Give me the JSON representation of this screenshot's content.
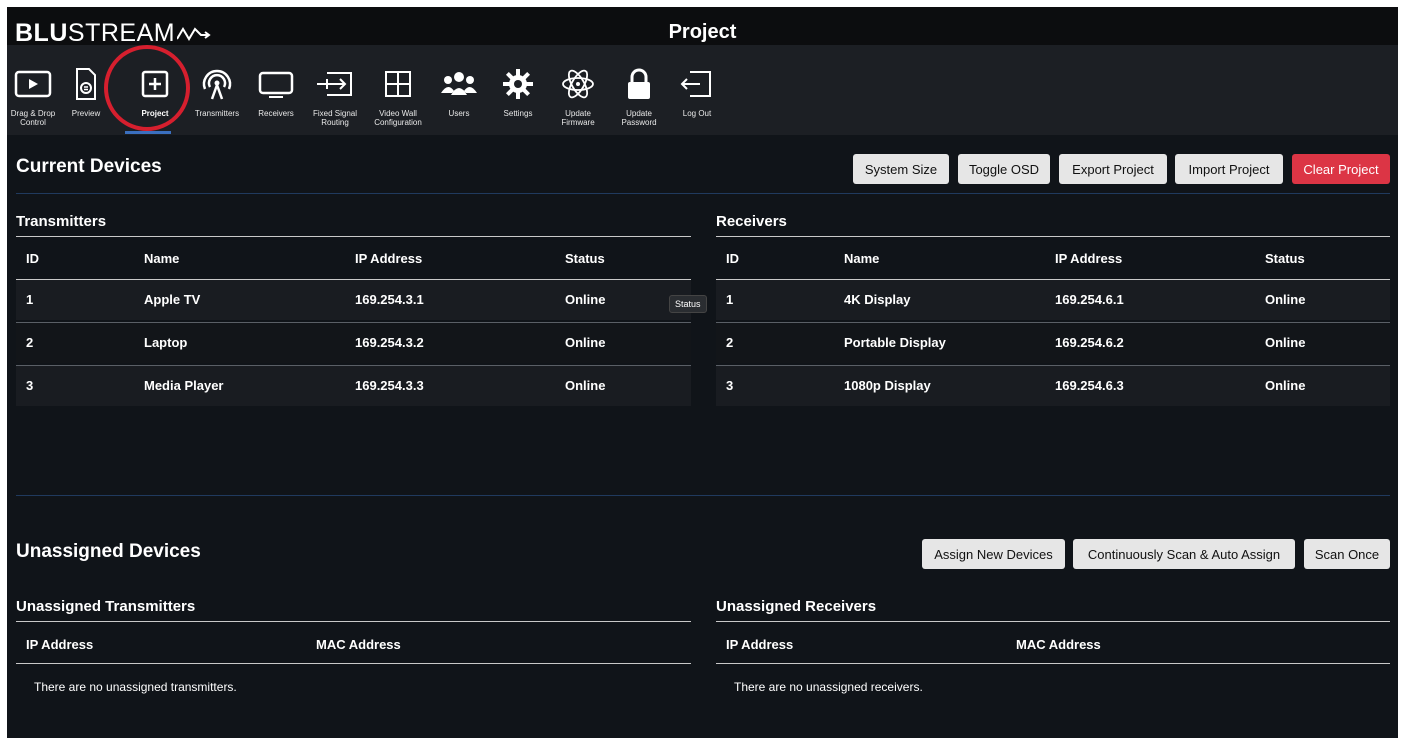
{
  "header": {
    "logo_bold": "BLU",
    "logo_rest": "STREAM",
    "page_title": "Project"
  },
  "toolbar": {
    "items": [
      {
        "label": "Drag & Drop\nControl",
        "icon": "play-screen-icon"
      },
      {
        "label": "Preview",
        "icon": "document-search-icon"
      },
      {
        "label": "Project",
        "icon": "plus-square-icon",
        "active": true
      },
      {
        "label": "Transmitters",
        "icon": "broadcast-icon"
      },
      {
        "label": "Receivers",
        "icon": "display-icon"
      },
      {
        "label": "Fixed Signal\nRouting",
        "icon": "routing-icon"
      },
      {
        "label": "Video Wall\nConfiguration",
        "icon": "grid-icon"
      },
      {
        "label": "Users",
        "icon": "users-icon"
      },
      {
        "label": "Settings",
        "icon": "gear-icon"
      },
      {
        "label": "Update\nFirmware",
        "icon": "atom-icon"
      },
      {
        "label": "Update\nPassword",
        "icon": "lock-icon"
      },
      {
        "label": "Log Out",
        "icon": "logout-icon"
      }
    ]
  },
  "current_devices": {
    "title": "Current Devices",
    "buttons": {
      "system_size": "System Size",
      "toggle_osd": "Toggle OSD",
      "export_project": "Export Project",
      "import_project": "Import Project",
      "clear_project": "Clear Project"
    },
    "transmitters": {
      "title": "Transmitters",
      "columns": [
        "ID",
        "Name",
        "IP Address",
        "Status"
      ],
      "rows": [
        [
          "1",
          "Apple TV",
          "169.254.3.1",
          "Online"
        ],
        [
          "2",
          "Laptop",
          "169.254.3.2",
          "Online"
        ],
        [
          "3",
          "Media Player",
          "169.254.3.3",
          "Online"
        ]
      ]
    },
    "receivers": {
      "title": "Receivers",
      "columns": [
        "ID",
        "Name",
        "IP Address",
        "Status"
      ],
      "rows": [
        [
          "1",
          "4K Display",
          "169.254.6.1",
          "Online"
        ],
        [
          "2",
          "Portable Display",
          "169.254.6.2",
          "Online"
        ],
        [
          "3",
          "1080p Display",
          "169.254.6.3",
          "Online"
        ]
      ]
    },
    "tooltip": "Status"
  },
  "unassigned_devices": {
    "title": "Unassigned Devices",
    "buttons": {
      "assign_new": "Assign New Devices",
      "continuous_scan": "Continuously Scan & Auto Assign",
      "scan_once": "Scan Once"
    },
    "transmitters": {
      "title": "Unassigned Transmitters",
      "columns": [
        "IP Address",
        "MAC Address"
      ],
      "empty": "There are no unassigned transmitters."
    },
    "receivers": {
      "title": "Unassigned Receivers",
      "columns": [
        "IP Address",
        "MAC Address"
      ],
      "empty": "There are no unassigned receivers."
    }
  },
  "colors": {
    "accent_red": "#dc3545",
    "background": "#101419",
    "toolbar": "#1c1f24"
  }
}
